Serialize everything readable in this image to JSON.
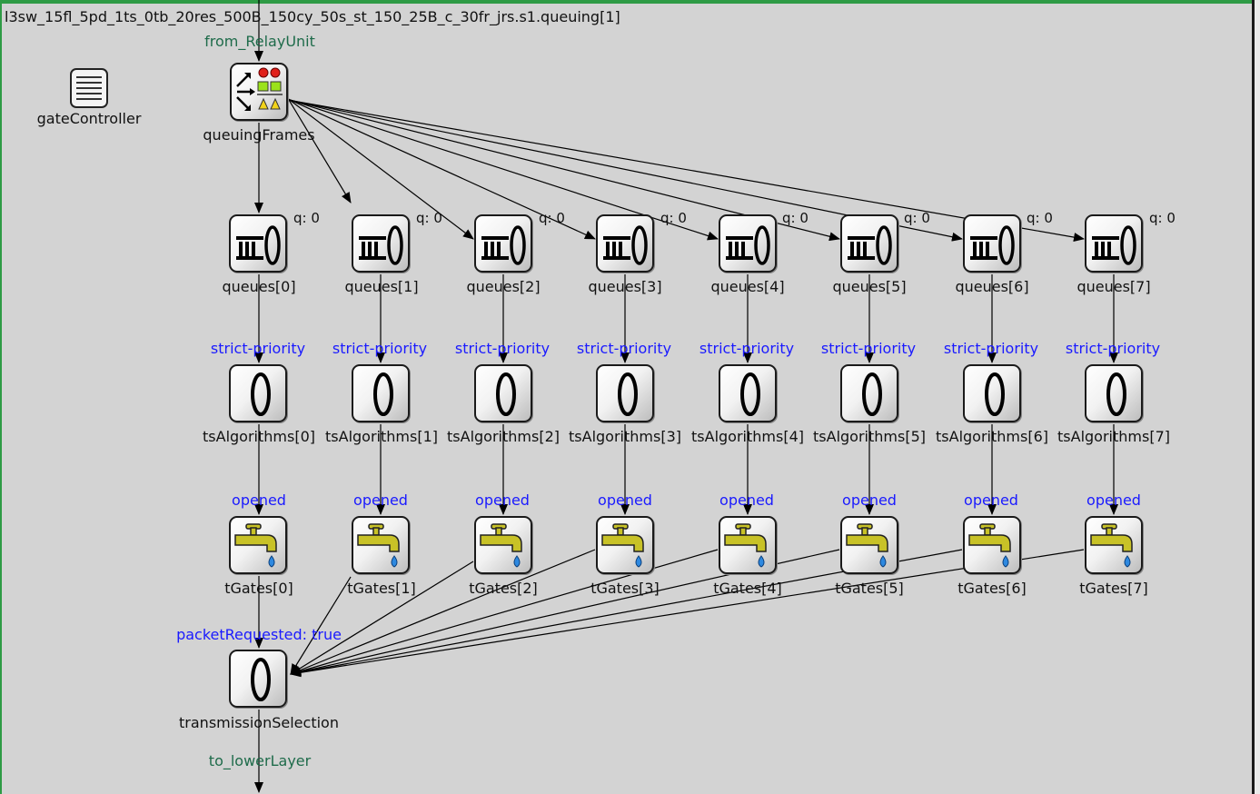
{
  "title": "l3sw_15fl_5pd_1ts_0tb_20res_500B_150cy_50s_st_150_25B_c_30fr_jrs.s1.queuing[1]",
  "gates": {
    "from": "from_RelayUnit",
    "to": "to_lowerLayer"
  },
  "gate_controller": {
    "label": "gateController",
    "icon": "list-icon"
  },
  "queuing_frames": {
    "label": "queuingFrames",
    "icon": "classifier-icon"
  },
  "queues": [
    {
      "label": "queues[0]",
      "q": "q: 0"
    },
    {
      "label": "queues[1]",
      "q": "q: 0"
    },
    {
      "label": "queues[2]",
      "q": "q: 0"
    },
    {
      "label": "queues[3]",
      "q": "q: 0"
    },
    {
      "label": "queues[4]",
      "q": "q: 0"
    },
    {
      "label": "queues[5]",
      "q": "q: 0"
    },
    {
      "label": "queues[6]",
      "q": "q: 0"
    },
    {
      "label": "queues[7]",
      "q": "q: 0"
    }
  ],
  "ts_algorithms": [
    {
      "label": "tsAlgorithms[0]",
      "status": "strict-priority"
    },
    {
      "label": "tsAlgorithms[1]",
      "status": "strict-priority"
    },
    {
      "label": "tsAlgorithms[2]",
      "status": "strict-priority"
    },
    {
      "label": "tsAlgorithms[3]",
      "status": "strict-priority"
    },
    {
      "label": "tsAlgorithms[4]",
      "status": "strict-priority"
    },
    {
      "label": "tsAlgorithms[5]",
      "status": "strict-priority"
    },
    {
      "label": "tsAlgorithms[6]",
      "status": "strict-priority"
    },
    {
      "label": "tsAlgorithms[7]",
      "status": "strict-priority"
    }
  ],
  "t_gates": [
    {
      "label": "tGates[0]",
      "status": "opened"
    },
    {
      "label": "tGates[1]",
      "status": "opened"
    },
    {
      "label": "tGates[2]",
      "status": "opened"
    },
    {
      "label": "tGates[3]",
      "status": "opened"
    },
    {
      "label": "tGates[4]",
      "status": "opened"
    },
    {
      "label": "tGates[5]",
      "status": "opened"
    },
    {
      "label": "tGates[6]",
      "status": "opened"
    },
    {
      "label": "tGates[7]",
      "status": "opened"
    }
  ],
  "transmission_selection": {
    "label": "transmissionSelection",
    "status": "packetRequested: true"
  },
  "icons": {
    "queue": "queue-icon",
    "algorithm": "ring-icon",
    "gate": "tap-icon"
  },
  "colors": {
    "canvas_bg": "#d3d3d3",
    "status_text": "#1a1aff",
    "gate_text": "#1e6b4a",
    "frame_border": "#2e9b45"
  }
}
